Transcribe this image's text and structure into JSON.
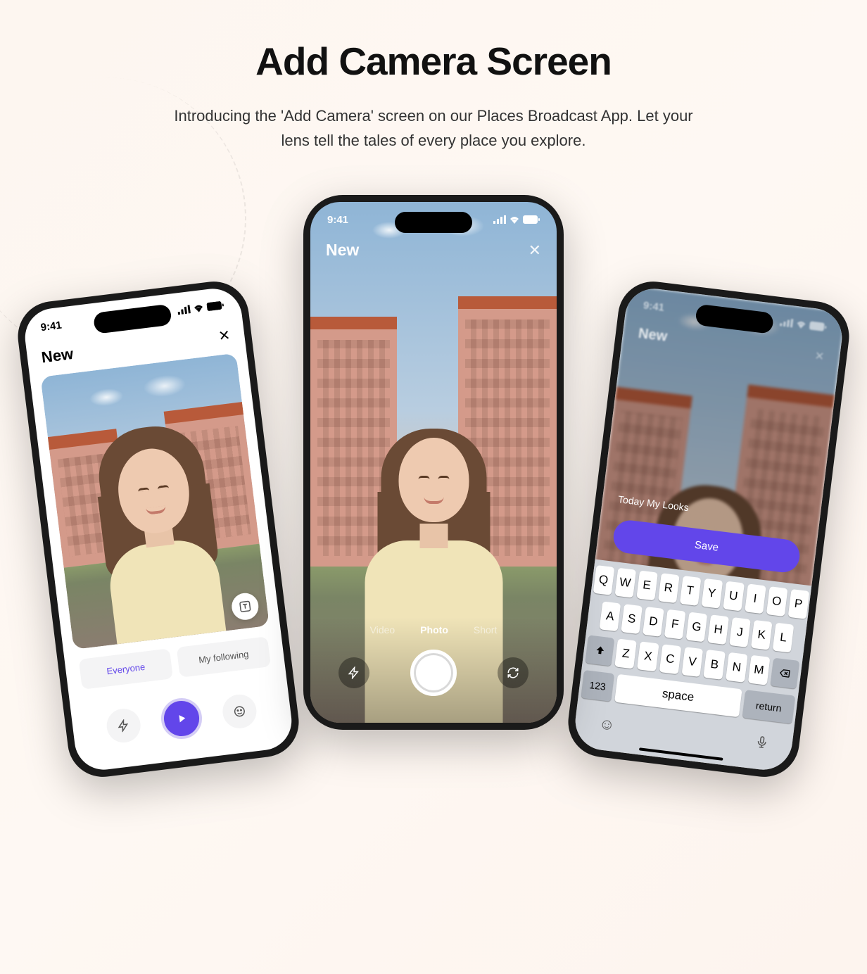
{
  "hero": {
    "title": "Add Camera Screen",
    "subtitle": "Introducing the 'Add Camera' screen on our Places Broadcast App. Let your lens tell the tales of every place you explore."
  },
  "status": {
    "time": "9:41"
  },
  "left": {
    "title": "New",
    "tabs": {
      "everyone": "Everyone",
      "following": "My following"
    }
  },
  "center": {
    "title": "New",
    "modes": {
      "video": "Video",
      "photo": "Photo",
      "short": "Short"
    }
  },
  "right": {
    "title": "New",
    "caption": "Today My Looks",
    "save": "Save",
    "keyboard": {
      "row1": [
        "Q",
        "W",
        "E",
        "R",
        "T",
        "Y",
        "U",
        "I",
        "O",
        "P"
      ],
      "row2": [
        "A",
        "S",
        "D",
        "F",
        "G",
        "H",
        "J",
        "K",
        "L"
      ],
      "row3": [
        "Z",
        "X",
        "C",
        "V",
        "B",
        "N",
        "M"
      ],
      "numKey": "123",
      "space": "space",
      "return": "return"
    }
  },
  "colors": {
    "accent": "#6246ea"
  }
}
